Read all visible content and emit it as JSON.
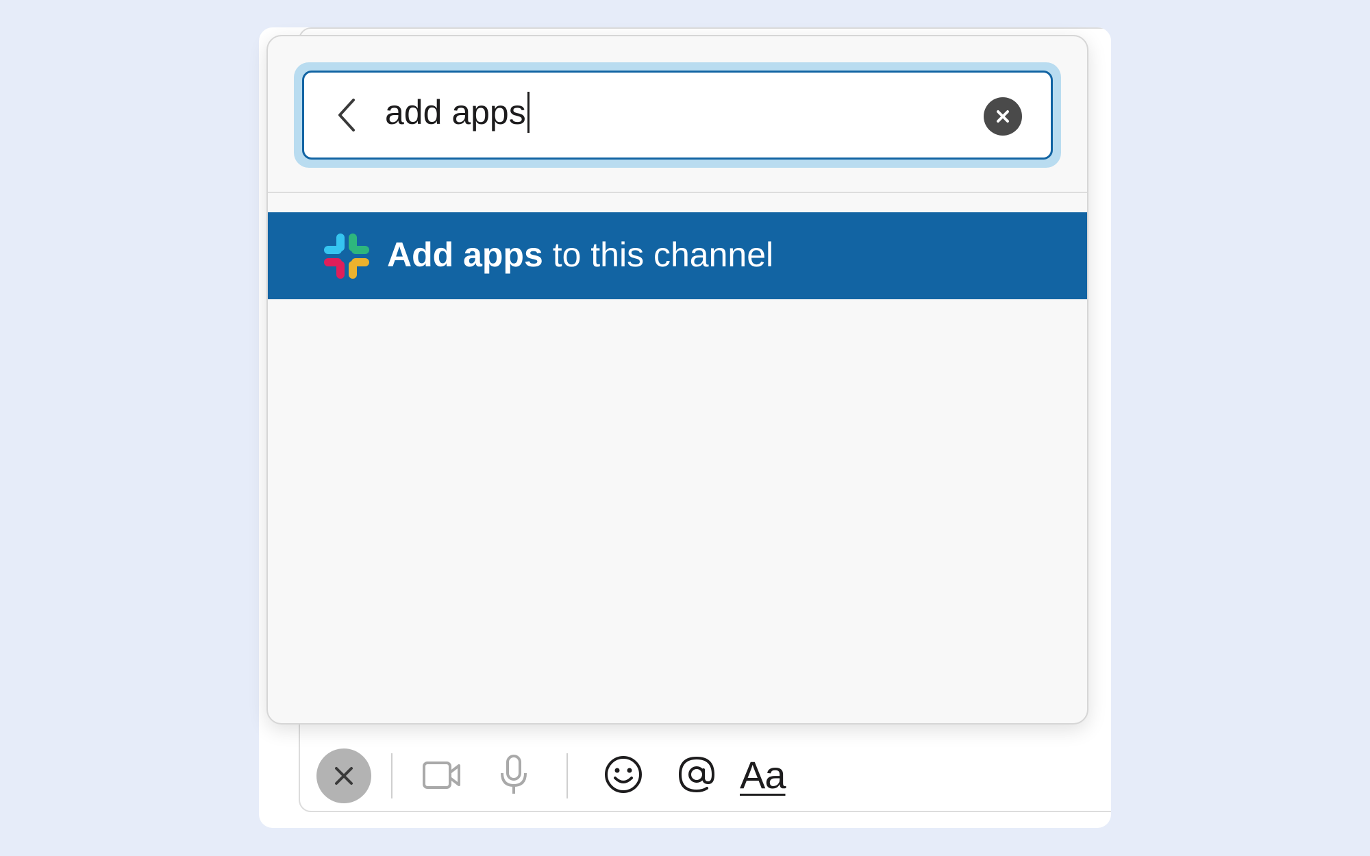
{
  "search": {
    "query": "add apps"
  },
  "results": [
    {
      "bold": "Add apps",
      "rest": " to this channel"
    }
  ],
  "toolbar": {
    "format_label": "Aa",
    "icons": [
      "close-icon",
      "video-icon",
      "microphone-icon",
      "emoji-icon",
      "mention-icon",
      "format-icon"
    ]
  },
  "colors": {
    "page_bg": "#e6ecf9",
    "highlight": "#1264a3",
    "focus_ring": "#b9dcf0"
  }
}
